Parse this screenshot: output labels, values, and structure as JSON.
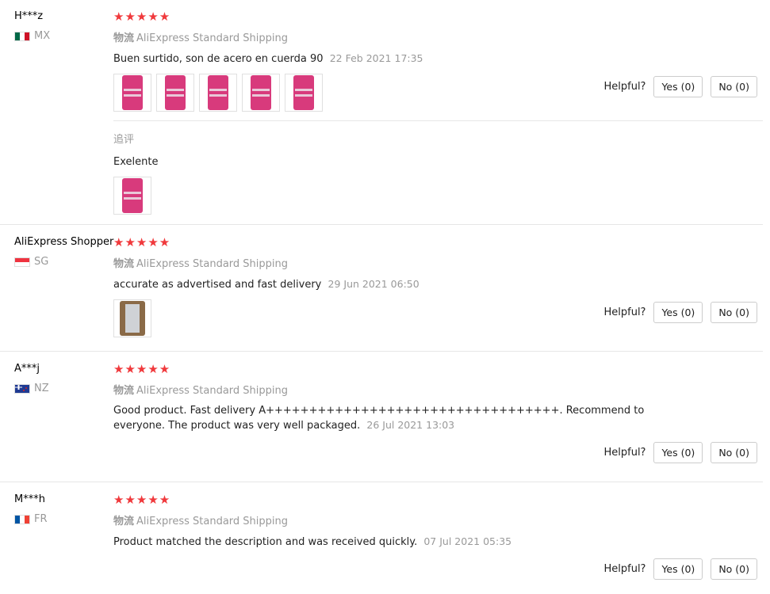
{
  "helpful_label": "Helpful?",
  "reviews": [
    {
      "user": "H***z",
      "country": "MX",
      "stars": "★★★★★",
      "shipping_label": "物流",
      "shipping": "AliExpress Standard Shipping",
      "comment": "Buen surtido, son de acero en cuerda 90",
      "date": "22 Feb 2021 17:35",
      "yes": "Yes (0)",
      "no": "No (0)",
      "followup_title": "追评",
      "followup_text": "Exelente"
    },
    {
      "user": "AliExpress Shopper",
      "country": "SG",
      "stars": "★★★★★",
      "shipping_label": "物流",
      "shipping": "AliExpress Standard Shipping",
      "comment": "accurate as advertised and fast delivery",
      "date": "29 Jun 2021 06:50",
      "yes": "Yes (0)",
      "no": "No (0)"
    },
    {
      "user": "A***j",
      "country": "NZ",
      "stars": "★★★★★",
      "shipping_label": "物流",
      "shipping": "AliExpress Standard Shipping",
      "comment": "Good product. Fast delivery A++++++++++++++++++++++++++++++++++. Recommend to everyone. The product was very well packaged.",
      "date": "26 Jul 2021 13:03",
      "yes": "Yes (0)",
      "no": "No (0)"
    },
    {
      "user": "M***h",
      "country": "FR",
      "stars": "★★★★★",
      "shipping_label": "物流",
      "shipping": "AliExpress Standard Shipping",
      "comment": "Product matched the description and was received quickly.",
      "date": "07 Jul 2021 05:35",
      "yes": "Yes (0)",
      "no": "No (0)"
    }
  ]
}
